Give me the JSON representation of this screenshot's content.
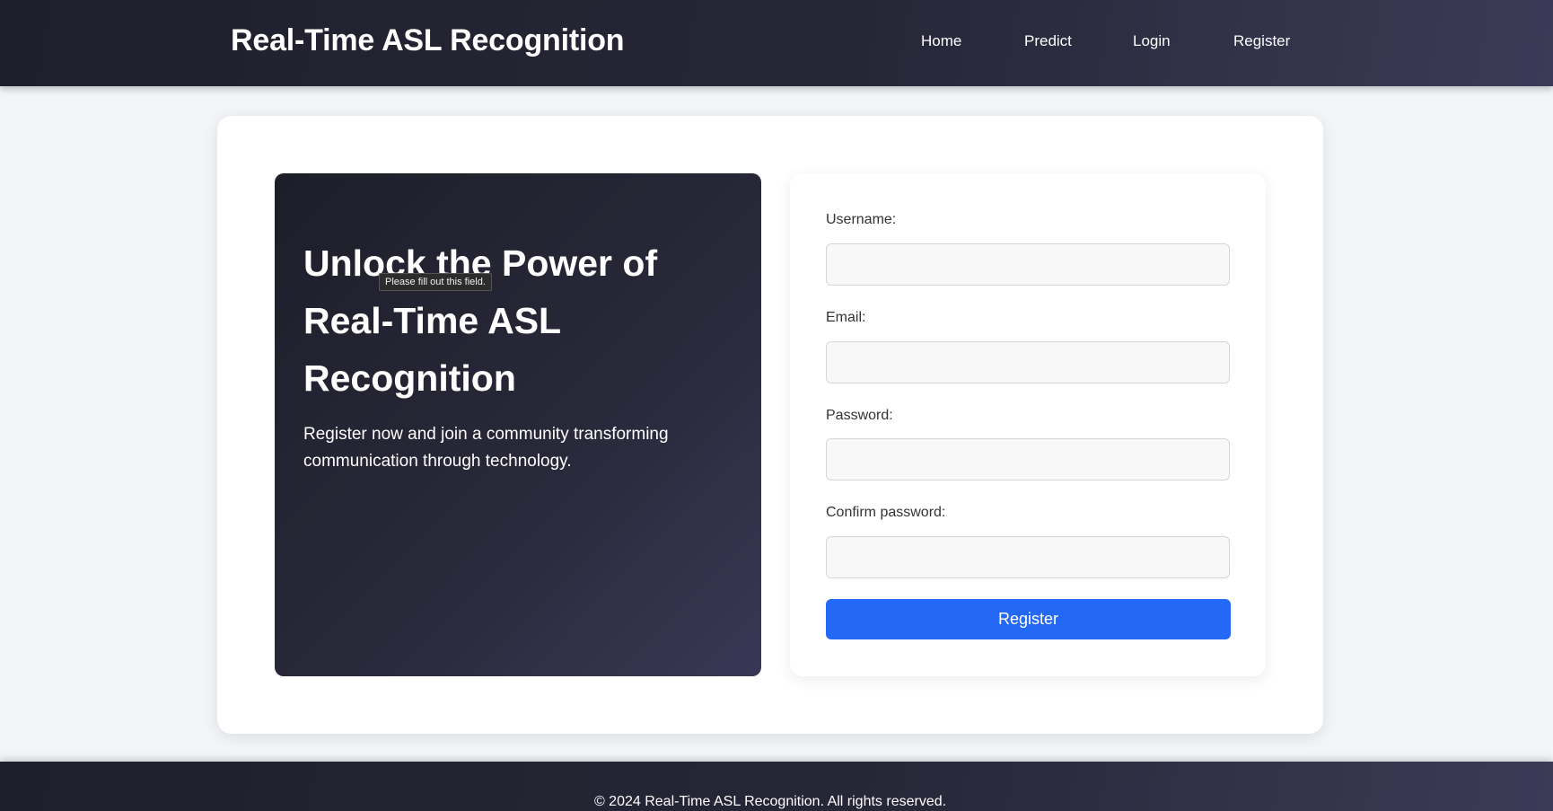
{
  "header": {
    "brand": "Real-Time ASL Recognition",
    "nav": [
      {
        "label": "Home"
      },
      {
        "label": "Predict"
      },
      {
        "label": "Login"
      },
      {
        "label": "Register"
      }
    ]
  },
  "hero": {
    "title": "Unlock the Power of Real-Time ASL Recognition",
    "text": "Register now and join a community transforming communication through technology."
  },
  "validation_tooltip": "Please fill out this field.",
  "form": {
    "username_label": "Username:",
    "username_value": "",
    "email_label": "Email:",
    "email_value": "",
    "password_label": "Password:",
    "password_value": "",
    "confirm_label": "Confirm password:",
    "confirm_value": "",
    "submit_label": "Register"
  },
  "footer": {
    "text": "© 2024 Real-Time ASL Recognition. All rights reserved."
  },
  "colors": {
    "accent": "#2469f6",
    "header_dark": "#1f1f2b",
    "page_bg": "#f3f5f9"
  }
}
